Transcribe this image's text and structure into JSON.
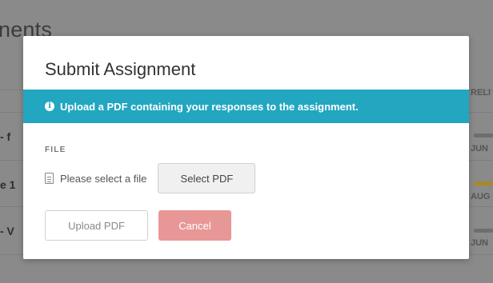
{
  "background": {
    "heading_fragment": "nents",
    "rows": [
      {
        "text": "- f"
      },
      {
        "text": "e 1"
      },
      {
        "text": "- V"
      }
    ],
    "right_labels": [
      "RELI",
      "JUN",
      "AUG",
      "JUN"
    ]
  },
  "modal": {
    "title": "Submit Assignment",
    "banner": {
      "icon": "info-icon",
      "text": "Upload a PDF containing your responses to the assignment."
    },
    "file_section": {
      "label": "FILE",
      "status": "Please select a file",
      "select_button": "Select PDF"
    },
    "actions": {
      "upload_button": "Upload PDF",
      "cancel_button": "Cancel"
    }
  },
  "colors": {
    "banner": "#23a6c0",
    "cancel": "#e89797"
  }
}
